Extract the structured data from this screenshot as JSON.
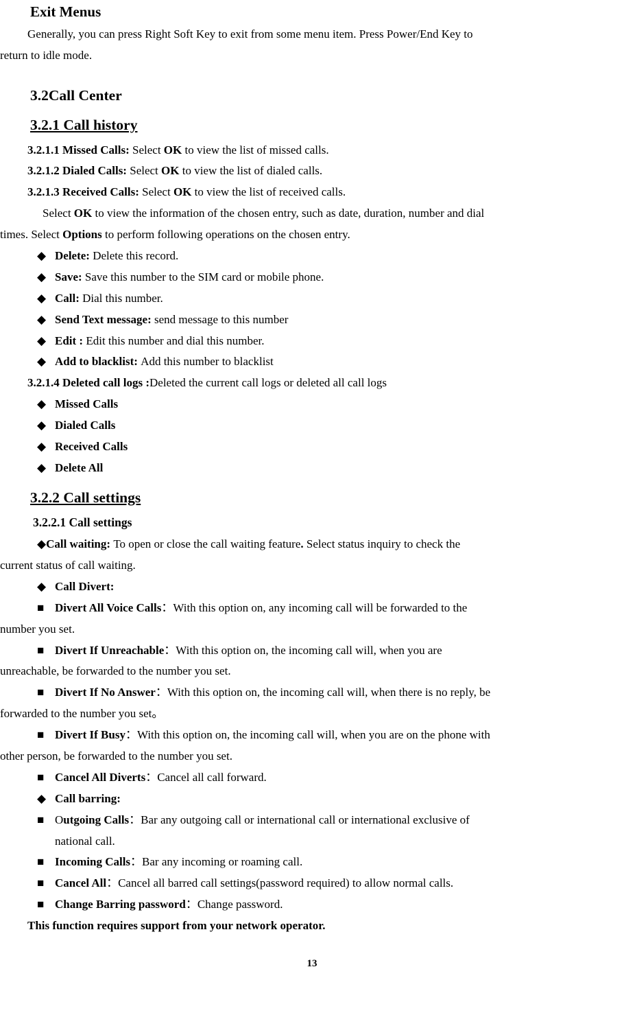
{
  "headings": {
    "exit_menus": "Exit Menus",
    "section_3_2": "3.2Call Center",
    "section_3_2_1": "3.2.1 Call history",
    "section_3_2_2": "3.2.2 Call settings",
    "section_3_2_2_1": "3.2.2.1 Call settings"
  },
  "exit_menus_para": {
    "t1": "Generally, you can press Right Soft Key to exit from some menu item. Press Power/End Key to",
    "t2": "return to idle mode."
  },
  "sub_3_2_1_1": {
    "label": "3.2.1.1 Missed Calls: ",
    "tail1": "Select ",
    "ok": "OK",
    "tail2": " to view the list of missed calls."
  },
  "sub_3_2_1_2": {
    "label": "3.2.1.2 Dialed Calls: ",
    "tail1": "Select ",
    "ok": "OK",
    "tail2": " to view the list of dialed calls."
  },
  "sub_3_2_1_3": {
    "label": "3.2.1.3 Received Calls: ",
    "tail1": "Select ",
    "ok": "OK",
    "tail2": " to view the list of received calls."
  },
  "info_para": {
    "t1a": "Select ",
    "t1ok": "OK",
    "t1b": " to view the information of the chosen entry, such as date, duration, number and dial",
    "t2a": "times. Select ",
    "t2opt": "Options",
    "t2b": " to perform following operations on the chosen entry."
  },
  "ops": {
    "delete": {
      "b": "Delete: ",
      "t": "Delete this record."
    },
    "save": {
      "b": "Save: ",
      "t": "Save this number to the SIM card or mobile phone."
    },
    "call": {
      "b": "Call: ",
      "t": "Dial this number."
    },
    "send": {
      "b": "Send Text message: ",
      "t": "send message to this number"
    },
    "edit": {
      "b": "Edit : ",
      "t": "Edit this number and dial this number."
    },
    "blacklist": {
      "b": "Add to blacklist: ",
      "t": "Add this number to blacklist"
    }
  },
  "sub_3_2_1_4": {
    "label": "3.2.1.4 Deleted call logs :",
    "tail": "Deleted the current call logs or deleted all call logs"
  },
  "del_logs": {
    "missed": "Missed Calls",
    "dialed": "Dialed Calls",
    "received": "Received Calls",
    "all": "Delete All"
  },
  "call_settings_bullets": {
    "call_waiting": {
      "b": "Call  waiting:  ",
      "t1": "To  open  or  close  the  call  waiting  feature",
      "dot": ".  ",
      "t2": "Select  status  inquiry  to  check  the",
      "cont": "current status of call waiting."
    },
    "call_divert_label": "Call Divert:",
    "divert_all_voice": {
      "b": "Divert  All  Voice  Calls",
      "colon": "：",
      "t": "With  this  option  on,  any  incoming  call  will  be  forwarded  to  the",
      "cont": "number you set."
    },
    "divert_unreachable": {
      "b": "Divert   If   Unreachable",
      "colon": "：",
      "t": "With   this   option   on,   the   incoming   call   will,   when   you   are",
      "cont": "unreachable, be forwarded to the number you set."
    },
    "divert_no_answer": {
      "b": "Divert If No Answer",
      "colon": "：",
      "t": "With this option on, the incoming call will, when there is no reply, be",
      "cont": "forwarded to the number you set。"
    },
    "divert_busy": {
      "b": "Divert If Busy",
      "colon": "：",
      "t": "With this option on, the incoming call will, when you are on the phone with",
      "cont": "other person, be forwarded to the number you set."
    },
    "cancel_diverts": {
      "b": "Cancel All Diverts",
      "colon": "：",
      "t": "Cancel all call forward."
    },
    "call_barring_label": "Call barring:",
    "outgoing": {
      "pre": "O",
      "b": "utgoing  Calls",
      "colon": "：",
      "t": "Bar  any  outgoing  call  or  international  call  or  international  exclusive  of",
      "cont": "national call."
    },
    "incoming": {
      "b": "Incoming Calls",
      "colon": "：",
      "t": "Bar any incoming or roaming call."
    },
    "cancel_all": {
      "b": "Cancel All",
      "colon": "：",
      "t": "Cancel all barred call settings(password required) to allow normal calls."
    },
    "change_pw": {
      "b": "Change Barring password",
      "colon": "：",
      "t": "Change password."
    }
  },
  "footer_note": "This function requires support from your network operator.",
  "page_number": "13",
  "glyphs": {
    "diamond": "◆",
    "square": "■"
  }
}
